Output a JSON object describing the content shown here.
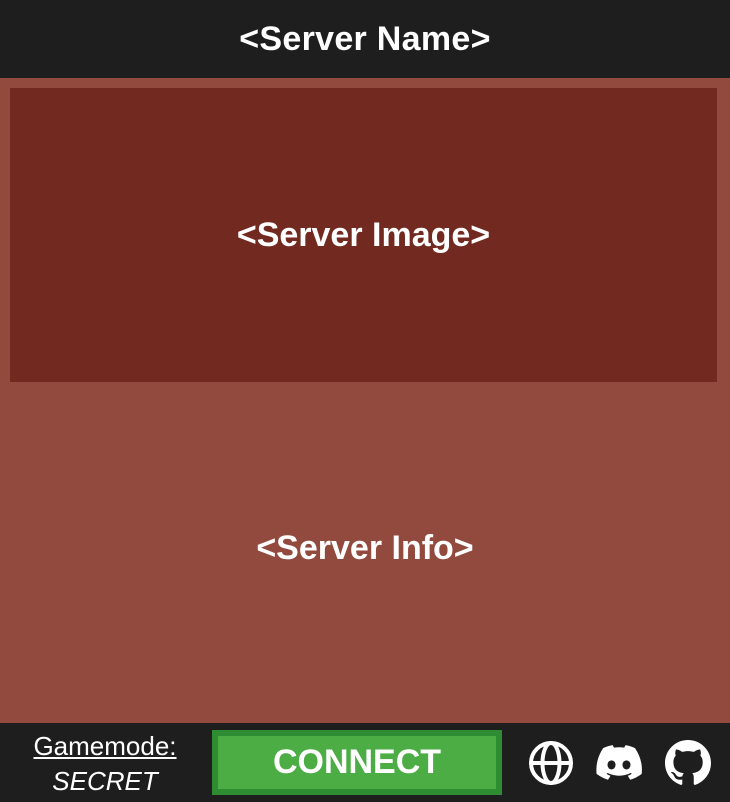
{
  "header": {
    "server_name": "<Server Name>"
  },
  "main": {
    "image_placeholder": "<Server Image>",
    "info_placeholder": "<Server Info>"
  },
  "footer": {
    "gamemode_label": "Gamemode:",
    "gamemode_value": "SECRET",
    "connect_label": "CONNECT",
    "icons": [
      "globe-icon",
      "discord-icon",
      "github-icon"
    ]
  },
  "colors": {
    "header_bg": "#1e1e1e",
    "panel_bg": "#934a3e",
    "image_bg": "#722a20",
    "connect_bg": "#4bad44",
    "connect_border": "#2e8d33",
    "text": "#ffffff"
  }
}
